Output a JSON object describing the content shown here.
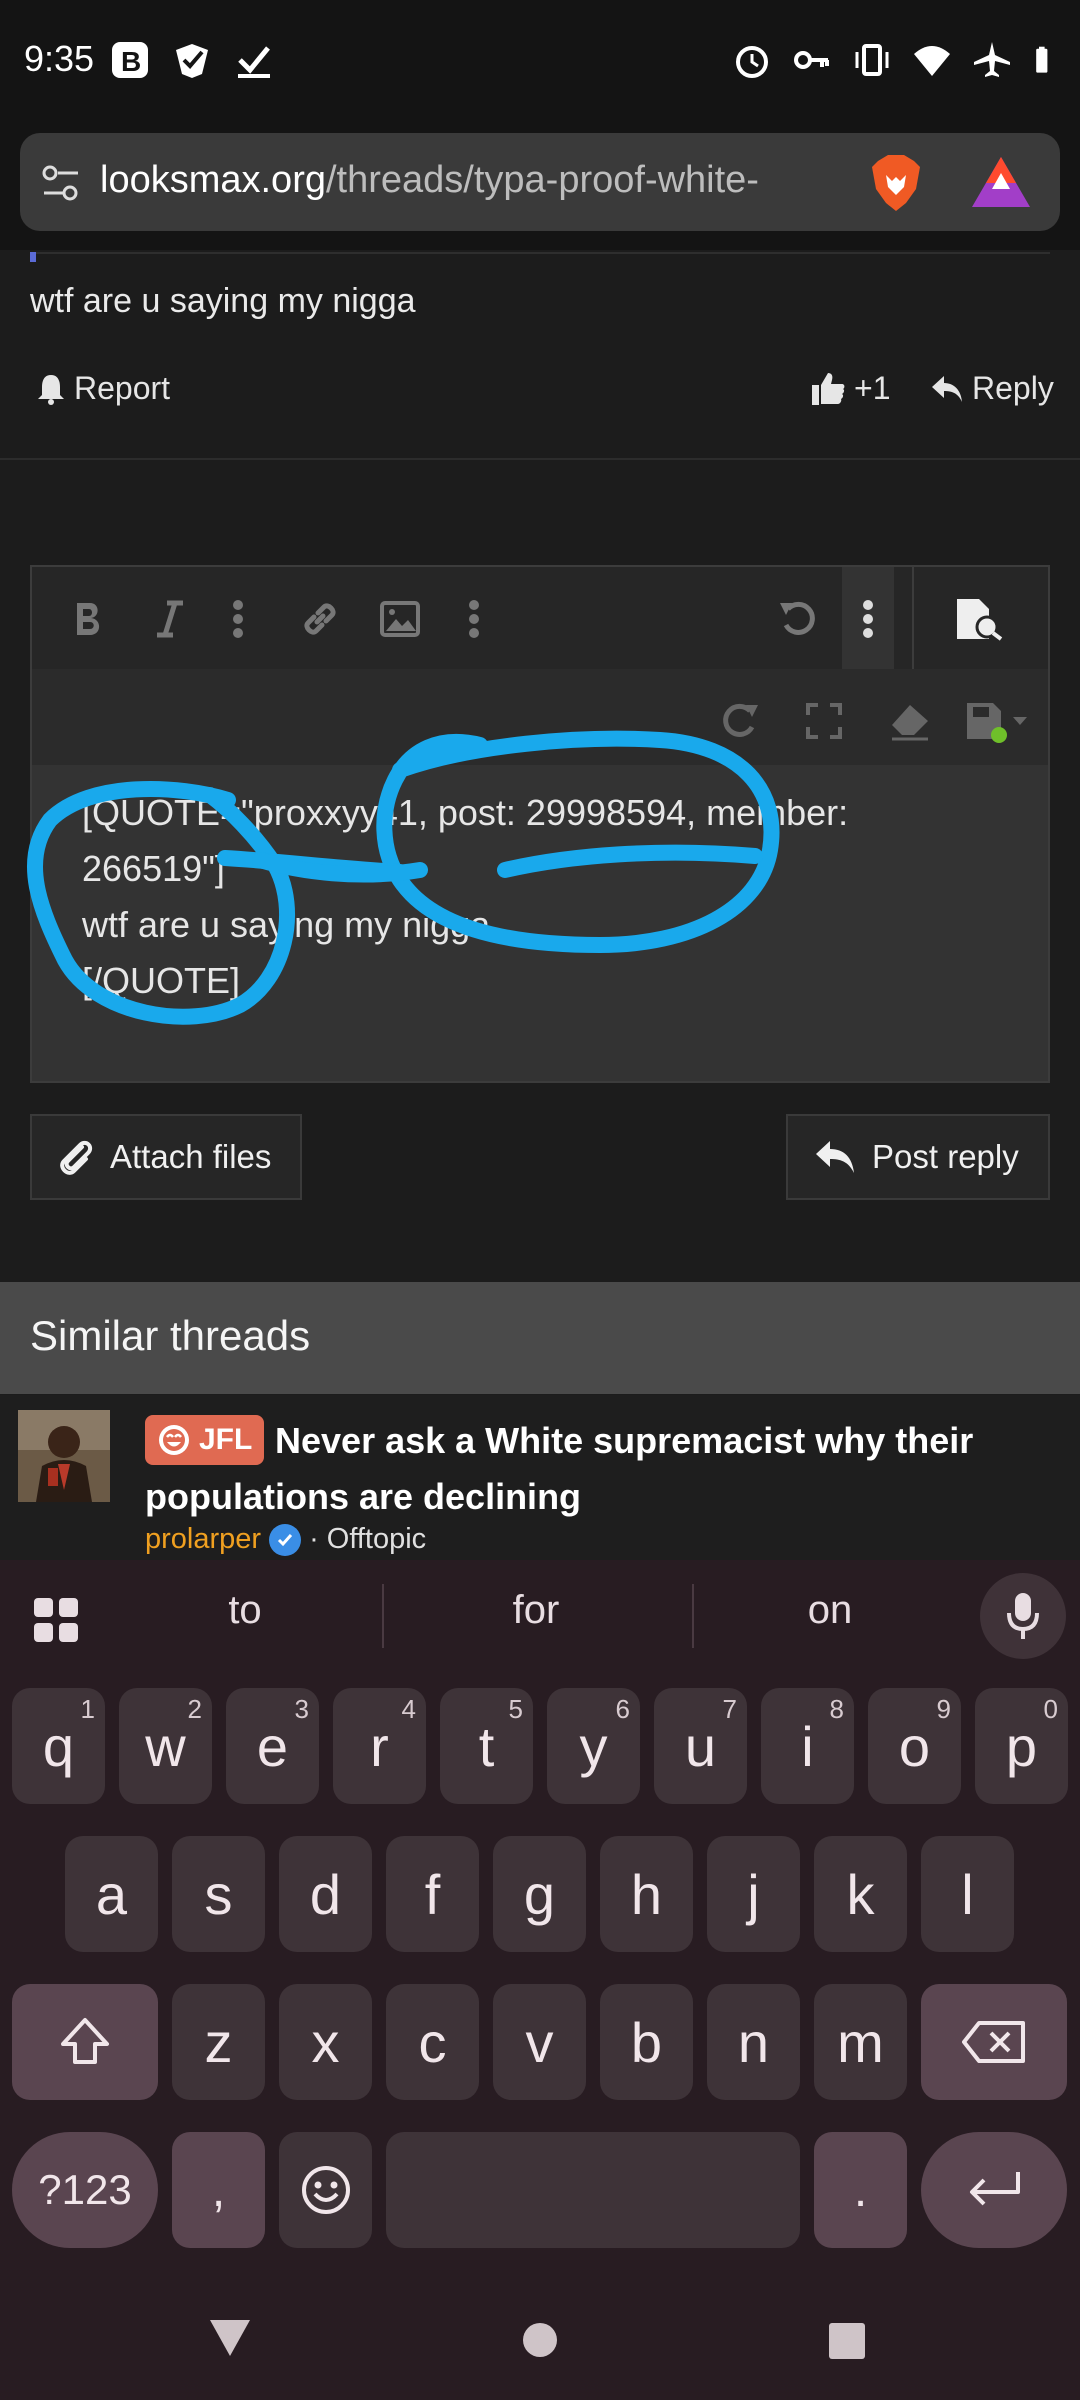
{
  "status_bar": {
    "time": "9:35",
    "left_icons": [
      "brave-b-icon",
      "shield-check-icon",
      "check-icon"
    ],
    "right_icons": [
      "alarm-icon",
      "vpn-key-icon",
      "vibrate-icon",
      "wifi-icon",
      "airplane-icon",
      "battery-icon"
    ]
  },
  "browser": {
    "url_host": "looksmax.org",
    "url_path": "/threads/typa-proof-white-"
  },
  "post": {
    "text": "wtf are u saying my nigga",
    "report_label": "Report",
    "like_count": "+1",
    "reply_label": "Reply"
  },
  "editor": {
    "content_line1": "[QUOTE=\"proxxyy41, post: 29998594, member:",
    "content_line2": "266519\"]",
    "content_line3": "wtf are u saying my nigga",
    "content_line4": "[/QUOTE]",
    "toolbar_icons": [
      "bold-icon",
      "italic-icon",
      "more-text-icon",
      "link-icon",
      "image-icon",
      "more-insert-icon",
      "undo-icon",
      "more-options-icon",
      "preview-icon",
      "redo-icon",
      "fullscreen-icon",
      "remove-format-icon",
      "draft-save-icon"
    ],
    "annotation_color": "#19a9ec"
  },
  "actions": {
    "attach_label": "Attach files",
    "post_reply_label": "Post reply"
  },
  "similar": {
    "heading": "Similar threads",
    "thread": {
      "prefix": "JFL",
      "title": "Never ask a White supremacist why their populations are declining",
      "author": "prolarper",
      "forum": "· Offtopic"
    }
  },
  "keyboard": {
    "suggestions": [
      "to",
      "for",
      "on"
    ],
    "row1": [
      {
        "k": "q",
        "h": "1"
      },
      {
        "k": "w",
        "h": "2"
      },
      {
        "k": "e",
        "h": "3"
      },
      {
        "k": "r",
        "h": "4"
      },
      {
        "k": "t",
        "h": "5"
      },
      {
        "k": "y",
        "h": "6"
      },
      {
        "k": "u",
        "h": "7"
      },
      {
        "k": "i",
        "h": "8"
      },
      {
        "k": "o",
        "h": "9"
      },
      {
        "k": "p",
        "h": "0"
      }
    ],
    "row2": [
      "a",
      "s",
      "d",
      "f",
      "g",
      "h",
      "j",
      "k",
      "l"
    ],
    "row3": [
      "z",
      "x",
      "c",
      "v",
      "b",
      "n",
      "m"
    ],
    "symbols_label": "?123",
    "comma": ",",
    "period": "."
  }
}
